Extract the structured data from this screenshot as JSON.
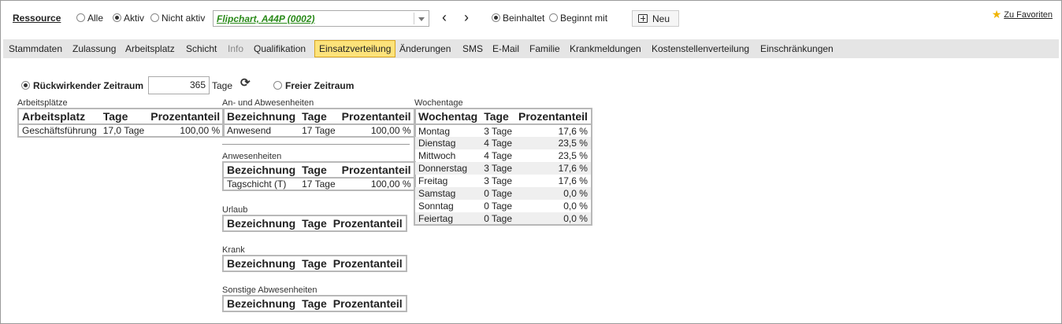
{
  "header": {
    "title": "Ressource",
    "filter_options": [
      {
        "label": "Alle",
        "selected": false
      },
      {
        "label": "Aktiv",
        "selected": true
      },
      {
        "label": "Nicht aktiv",
        "selected": false
      }
    ],
    "resource_select_value": "Flipchart, A44P (0002)",
    "match_options": [
      {
        "label": "Beinhaltet",
        "selected": true
      },
      {
        "label": "Beginnt mit",
        "selected": false
      }
    ],
    "new_button_label": "Neu",
    "favorites_label": "Zu Favoriten",
    "prev_icon": "chevron-left-icon",
    "next_icon": "chevron-right-icon"
  },
  "tabs": [
    {
      "label": "Stammdaten"
    },
    {
      "label": "Zulassung"
    },
    {
      "label": "Arbeitsplatz"
    },
    {
      "label": "Schicht"
    },
    {
      "label": "Info",
      "disabled": true
    },
    {
      "label": "Qualifikation"
    },
    {
      "label": "Einsatzverteilung",
      "active": true
    },
    {
      "label": "Änderungen"
    },
    {
      "label": "SMS"
    },
    {
      "label": "E-Mail"
    },
    {
      "label": "Familie"
    },
    {
      "label": "Krankmeldungen"
    },
    {
      "label": "Kostenstellenverteilung"
    },
    {
      "label": "Einschränkungen"
    }
  ],
  "period": {
    "retro_label": "Rückwirkender Zeitraum",
    "retro_selected": true,
    "days_value": "365",
    "days_unit": "Tage",
    "free_label": "Freier Zeitraum",
    "free_selected": false
  },
  "arbeitsplaetze": {
    "label": "Arbeitsplätze",
    "headers": [
      "Arbeitsplatz",
      "Tage",
      "Prozentanteil"
    ],
    "rows": [
      [
        "Geschäftsführung",
        "17,0 Tage",
        "100,00 %"
      ]
    ]
  },
  "an_abwesenheiten": {
    "label": "An- und Abwesenheiten",
    "headers": [
      "Bezeichnung",
      "Tage",
      "Prozentanteil"
    ],
    "rows": [
      [
        "Anwesend",
        "17 Tage",
        "100,00 %"
      ]
    ]
  },
  "anwesenheiten": {
    "label": "Anwesenheiten",
    "headers": [
      "Bezeichnung",
      "Tage",
      "Prozentanteil"
    ],
    "rows": [
      [
        "Tagschicht (T)",
        "17 Tage",
        "100,00 %"
      ]
    ]
  },
  "urlaub": {
    "label": "Urlaub",
    "headers": [
      "Bezeichnung",
      "Tage",
      "Prozentanteil"
    ]
  },
  "krank": {
    "label": "Krank",
    "headers": [
      "Bezeichnung",
      "Tage",
      "Prozentanteil"
    ]
  },
  "sonstige": {
    "label": "Sonstige Abwesenheiten",
    "headers": [
      "Bezeichnung",
      "Tage",
      "Prozentanteil"
    ]
  },
  "wochentage": {
    "label": "Wochentage",
    "headers": [
      "Wochentag",
      "Tage",
      "Prozentanteil"
    ],
    "rows": [
      [
        "Montag",
        "3 Tage",
        "17,6 %"
      ],
      [
        "Dienstag",
        "4 Tage",
        "23,5 %"
      ],
      [
        "Mittwoch",
        "4 Tage",
        "23,5 %"
      ],
      [
        "Donnerstag",
        "3 Tage",
        "17,6 %"
      ],
      [
        "Freitag",
        "3 Tage",
        "17,6 %"
      ],
      [
        "Samstag",
        "0 Tage",
        "0,0 %"
      ],
      [
        "Sonntag",
        "0 Tage",
        "0,0 %"
      ],
      [
        "Feiertag",
        "0 Tage",
        "0,0 %"
      ]
    ]
  }
}
